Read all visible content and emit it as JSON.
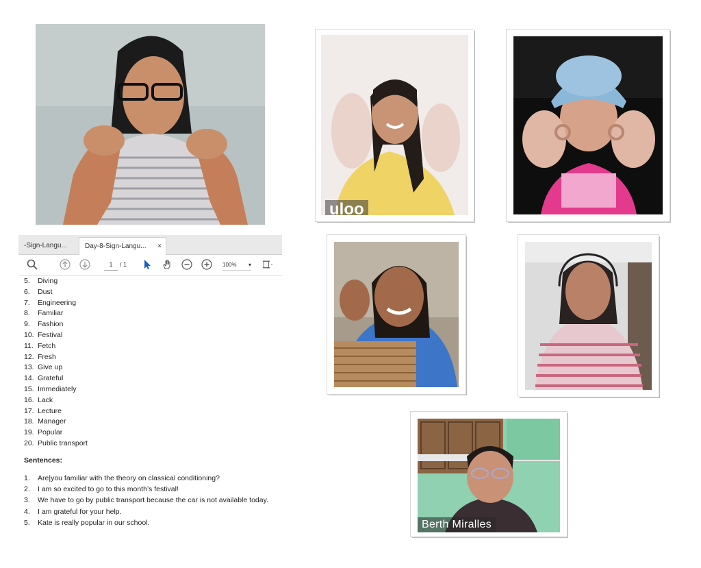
{
  "pdf_viewer": {
    "tabs": [
      {
        "label": "-Sign-Langu..."
      },
      {
        "label": "Day-8-Sign-Langu...",
        "close": "×"
      }
    ],
    "toolbar": {
      "page_current": "1",
      "page_total": "/ 1",
      "zoom": "100%",
      "zoom_caret": "▾"
    },
    "words": [
      {
        "num": "5.",
        "text": "Diving"
      },
      {
        "num": "6.",
        "text": "Dust"
      },
      {
        "num": "7.",
        "text": "Engineering"
      },
      {
        "num": "8.",
        "text": "Familiar"
      },
      {
        "num": "9.",
        "text": "Fashion"
      },
      {
        "num": "10.",
        "text": "Festival"
      },
      {
        "num": "11.",
        "text": "Fetch"
      },
      {
        "num": "12.",
        "text": "Fresh"
      },
      {
        "num": "13.",
        "text": "Give up"
      },
      {
        "num": "14.",
        "text": "Grateful"
      },
      {
        "num": "15.",
        "text": "Immediately"
      },
      {
        "num": "16.",
        "text": "Lack"
      },
      {
        "num": "17.",
        "text": "Lecture"
      },
      {
        "num": "18.",
        "text": "Manager"
      },
      {
        "num": "19.",
        "text": "Popular"
      },
      {
        "num": "20.",
        "text": "Public transport"
      }
    ],
    "sentences_heading": "Sentences:",
    "sentences": [
      {
        "num": "1.",
        "text": "Are|you familiar with the theory on classical conditioning?"
      },
      {
        "num": "2.",
        "text": "I am so excited to go to this month’s festival!"
      },
      {
        "num": "3.",
        "text": "We have to go by public transport because the car is not available today."
      },
      {
        "num": "4.",
        "text": "I am grateful for your help."
      },
      {
        "num": "5.",
        "text": "Kate is really popular in our school."
      }
    ]
  },
  "participants": {
    "top_left_name": "uloo",
    "bottom_name": "Berth Miralles"
  }
}
